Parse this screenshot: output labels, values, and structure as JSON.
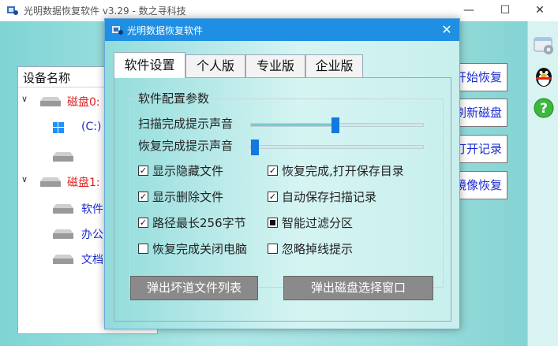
{
  "main_window": {
    "title": "光明数据恢复软件 v3.29 - 数之寻科技",
    "controls": {
      "minimize": "—",
      "maximize": "☐",
      "close": "✕"
    }
  },
  "device_panel": {
    "header": "设备名称",
    "tree": [
      {
        "label": "磁盘0:",
        "kind": "disk",
        "arrow": "∨"
      },
      {
        "label": "(C:)",
        "kind": "partition"
      },
      {
        "label": "",
        "kind": "partition"
      },
      {
        "label": "磁盘1:",
        "kind": "disk",
        "arrow": "∨"
      },
      {
        "label": "软件",
        "kind": "partition"
      },
      {
        "label": "办公",
        "kind": "partition"
      },
      {
        "label": "文档",
        "kind": "partition"
      }
    ]
  },
  "side_buttons": [
    {
      "label": "开始恢复"
    },
    {
      "label": "刷新磁盘"
    },
    {
      "label": "打开记录"
    },
    {
      "label": "镜像恢复"
    }
  ],
  "right_strip_icons": [
    "settings-window-icon",
    "qq-penguin-icon",
    "help-icon"
  ],
  "dialog": {
    "title": "光明数据恢复软件",
    "close": "✕",
    "tabs": [
      {
        "label": "软件设置",
        "active": true
      },
      {
        "label": "个人版",
        "active": false
      },
      {
        "label": "专业版",
        "active": false
      },
      {
        "label": "企业版",
        "active": false
      }
    ],
    "group_title": "软件配置参数",
    "sliders": [
      {
        "label": "扫描完成提示声音",
        "value_fraction": 0.49
      },
      {
        "label": "恢复完成提示声音",
        "value_fraction": 0.0
      }
    ],
    "checkboxes": [
      {
        "label": "显示隐藏文件",
        "state": "checked"
      },
      {
        "label": "恢复完成,打开保存目录",
        "state": "checked"
      },
      {
        "label": "显示删除文件",
        "state": "checked"
      },
      {
        "label": "自动保存扫描记录",
        "state": "checked"
      },
      {
        "label": "路径最长256字节",
        "state": "checked"
      },
      {
        "label": "智能过滤分区",
        "state": "indeterminate"
      },
      {
        "label": "恢复完成关闭电脑",
        "state": "unchecked"
      },
      {
        "label": "忽略掉线提示",
        "state": "unchecked"
      }
    ],
    "buttons": {
      "bad_sector": "弹出坏道文件列表",
      "disk_select": "弹出磁盘选择窗口"
    }
  },
  "colors": {
    "dialog_titlebar": "#1f8fe3",
    "disk_label": "#e02020",
    "partition_label": "#1a2bd0",
    "slider_thumb": "#1179e0"
  }
}
